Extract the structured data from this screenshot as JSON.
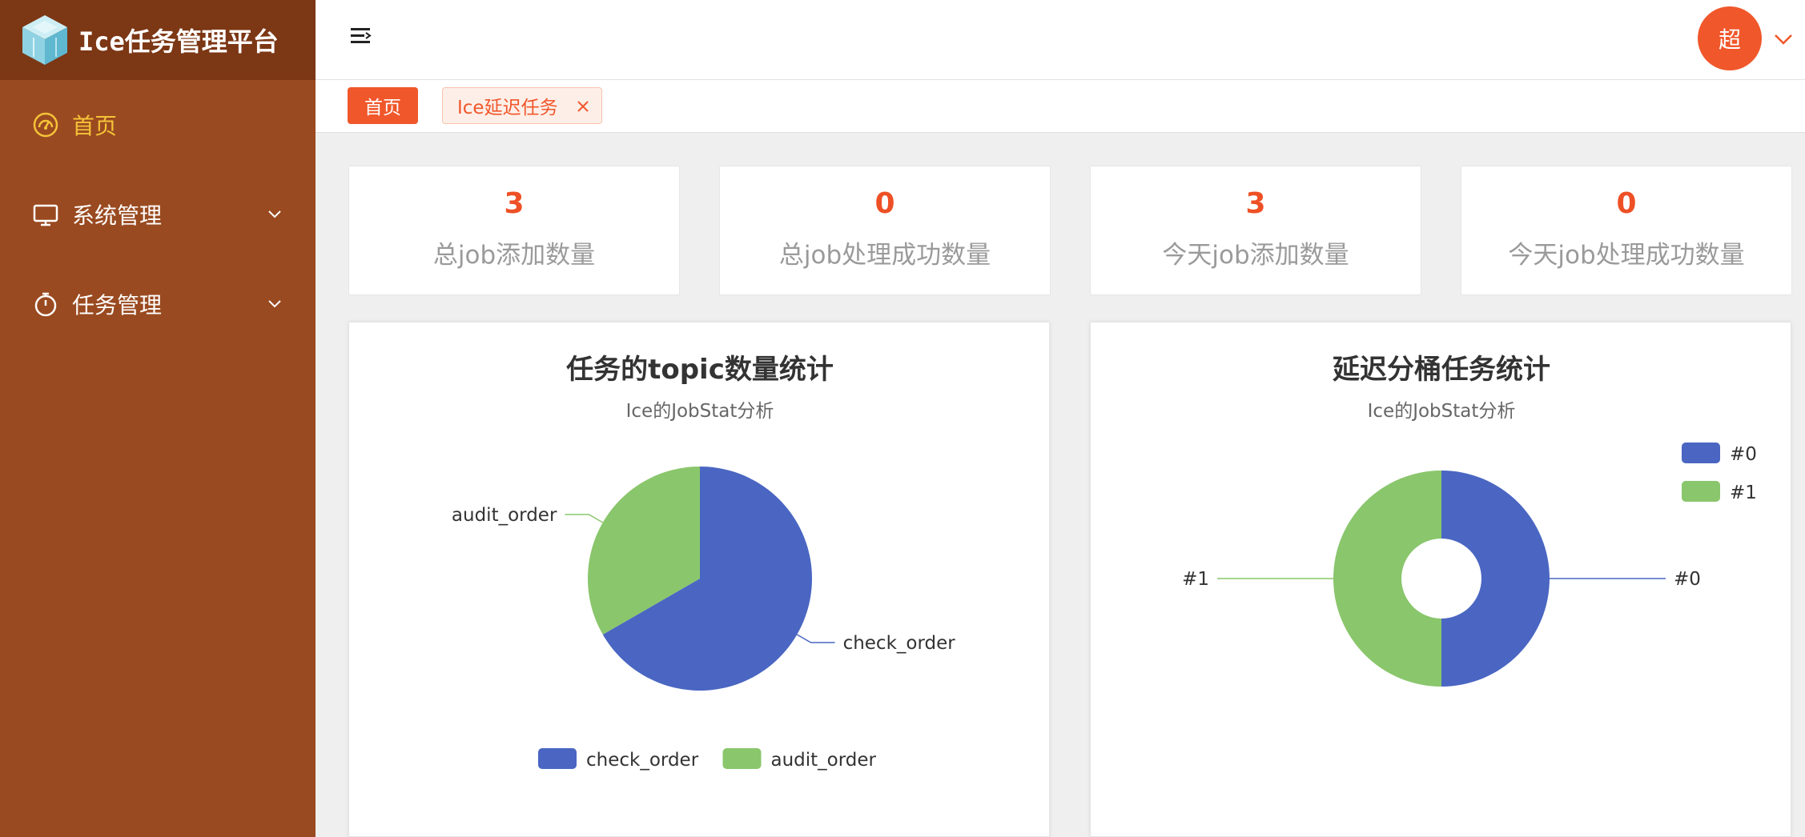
{
  "app": {
    "title": "Ice任务管理平台"
  },
  "sidebar": {
    "items": [
      {
        "label": "首页",
        "icon": "dashboard-icon",
        "active": true
      },
      {
        "label": "系统管理",
        "icon": "monitor-icon",
        "expandable": true
      },
      {
        "label": "任务管理",
        "icon": "timer-icon",
        "expandable": true
      }
    ]
  },
  "header": {
    "avatar_text": "超"
  },
  "tabs": [
    {
      "label": "首页",
      "active": true
    },
    {
      "label": "Ice延迟任务",
      "closable": true
    }
  ],
  "stats": [
    {
      "value": "3",
      "label": "总job添加数量"
    },
    {
      "value": "0",
      "label": "总job处理成功数量"
    },
    {
      "value": "3",
      "label": "今天job添加数量"
    },
    {
      "value": "0",
      "label": "今天job处理成功数量"
    }
  ],
  "colors": {
    "sidebar_bg": "#9a4a20",
    "logo_bg": "#7c3714",
    "accent": "#f0572a",
    "active_menu": "#f5c338",
    "series_blue": "#4a66c2",
    "series_green": "#8ac66c"
  },
  "chart_data": [
    {
      "type": "pie",
      "title": "任务的topic数量统计",
      "subtitle": "Ice的JobStat分析",
      "categories": [
        "check_order",
        "audit_order"
      ],
      "values": [
        2,
        1
      ],
      "colors": [
        "#4a66c2",
        "#8ac66c"
      ],
      "legend": "bottom"
    },
    {
      "type": "pie",
      "title": "延迟分桶任务统计",
      "subtitle": "Ice的JobStat分析",
      "categories": [
        "#0",
        "#1"
      ],
      "values": [
        1,
        1
      ],
      "colors": [
        "#4a66c2",
        "#8ac66c"
      ],
      "donut": true,
      "legend": "top-right"
    }
  ]
}
